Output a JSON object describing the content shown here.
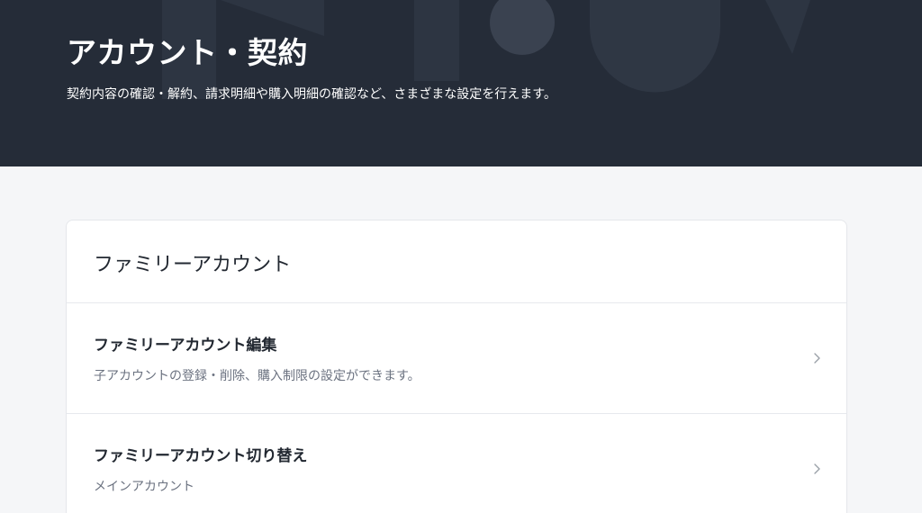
{
  "hero": {
    "title": "アカウント・契約",
    "description": "契約内容の確認・解約、請求明細や購入明細の確認など、さまざまな設定を行えます。"
  },
  "family_section": {
    "title": "ファミリーアカウント",
    "items": [
      {
        "title": "ファミリーアカウント編集",
        "description": "子アカウントの登録・削除、購入制限の設定ができます。",
        "icon": "chevron-right-icon"
      },
      {
        "title": "ファミリーアカウント切り替え",
        "description": "メインアカウント",
        "icon": "chevron-right-icon"
      }
    ]
  },
  "colors": {
    "hero_background": "#252c38",
    "page_background": "#f5f6f8",
    "card_background": "#ffffff",
    "muted_text": "#6b7280"
  }
}
